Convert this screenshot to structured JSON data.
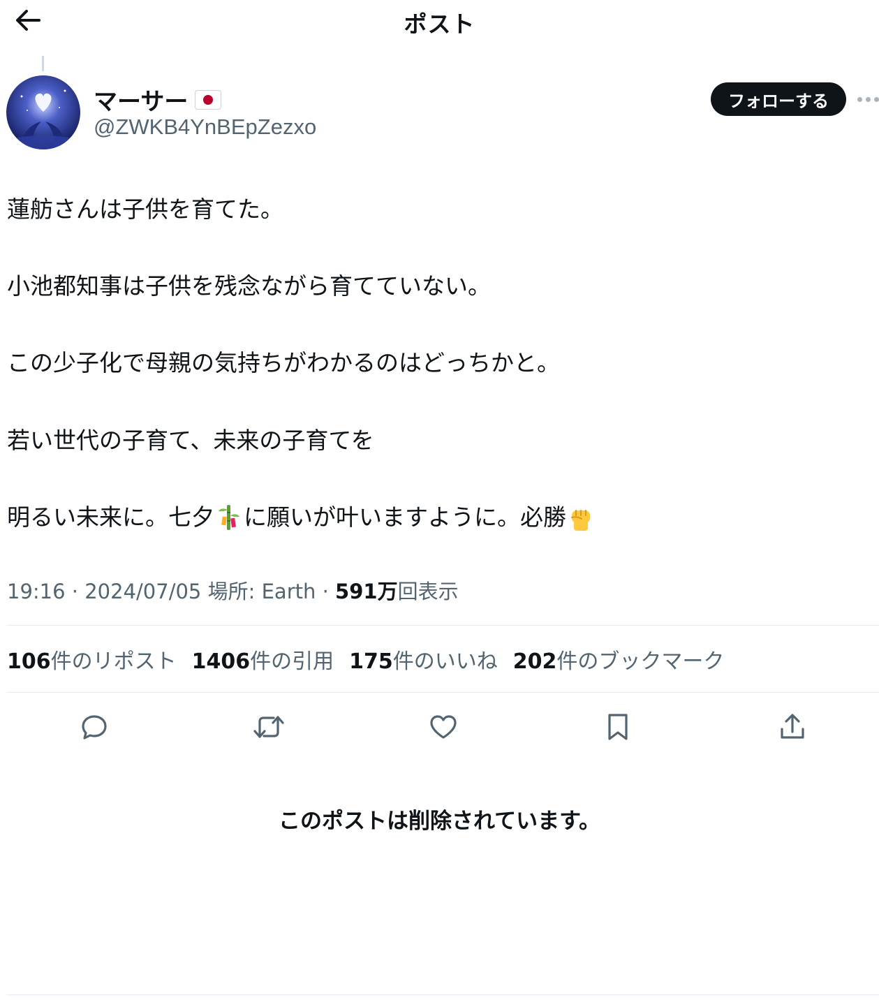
{
  "header": {
    "title": "ポスト",
    "back_icon": "arrow-left-icon"
  },
  "author": {
    "display_name": "マーサー",
    "flag_icon": "japan-flag-icon",
    "handle": "@ZWKB4YnBEpZezxo",
    "follow_label": "フォローする",
    "more_icon": "more-horizontal-icon"
  },
  "post": {
    "line1": "蓮舫さんは子供を育てた。",
    "line2": "小池都知事は子供を残念ながら育てていない。",
    "line3": "この少子化で母親の気持ちがわかるのはどっちかと。",
    "line4": "若い世代の子育て、未来の子育てを",
    "line5_a": "明るい未来に。七夕",
    "line5_b": "に願いが叶いますように。必勝",
    "emoji_bamboo": "tanabata-tree-emoji",
    "emoji_fist": "raised-fist-emoji"
  },
  "meta": {
    "time": "19:16",
    "separator": "·",
    "date": "2024/07/05",
    "location_label": "場所: Earth",
    "views_count": "591万",
    "views_label": "回表示"
  },
  "stats": {
    "reposts_count": "106",
    "reposts_label": "件のリポスト",
    "quotes_count": "1406",
    "quotes_label": "件の引用",
    "likes_count": "175",
    "likes_label": "件のいいね",
    "bookmarks_count": "202",
    "bookmarks_label": "件のブックマーク"
  },
  "actions": {
    "reply_icon": "reply-icon",
    "repost_icon": "repost-icon",
    "like_icon": "heart-icon",
    "bookmark_icon": "bookmark-icon",
    "share_icon": "share-icon"
  },
  "deleted_notice": "このポストは削除されています。",
  "colors": {
    "text_primary": "#0f1419",
    "text_secondary": "#536471",
    "divider": "#e6ecf0",
    "follow_bg": "#0f1419"
  }
}
